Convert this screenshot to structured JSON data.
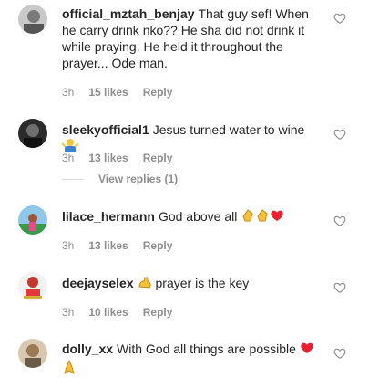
{
  "comments": [
    {
      "username": "official_mztah_benjay",
      "text": "That guy sef! When he carry drink nko?? He sha did not drink it while praying. He held it throughout the prayer... Ode man.",
      "time": "3h",
      "likes": "15 likes",
      "reply": "Reply"
    },
    {
      "username": "sleekyofficial1",
      "text": "Jesus turned water to wine",
      "time": "3h",
      "likes": "13 likes",
      "reply": "Reply",
      "view_replies": "View replies (1)"
    },
    {
      "username": "lilace_hermann",
      "text": "God above all",
      "time": "3h",
      "likes": "13 likes",
      "reply": "Reply"
    },
    {
      "username": "deejayselex",
      "text": "prayer is the key",
      "time": "3h",
      "likes": "10 likes",
      "reply": "Reply"
    },
    {
      "username": "dolly_xx",
      "text": "With God all things are possible",
      "time": "",
      "likes": "",
      "reply": ""
    }
  ],
  "icons": {
    "like": "heart-outline-icon",
    "emoji_shrug": "person-shrugging-emoji",
    "emoji_clap": "clapping-hands-emoji",
    "emoji_heart": "red-heart-emoji",
    "emoji_muscle": "flexed-biceps-emoji",
    "emoji_pray": "folded-hands-emoji"
  },
  "colors": {
    "text": "#262626",
    "secondary": "#8e8e8e",
    "heart_red": "#ed4956",
    "divider": "#dbdbdb"
  }
}
